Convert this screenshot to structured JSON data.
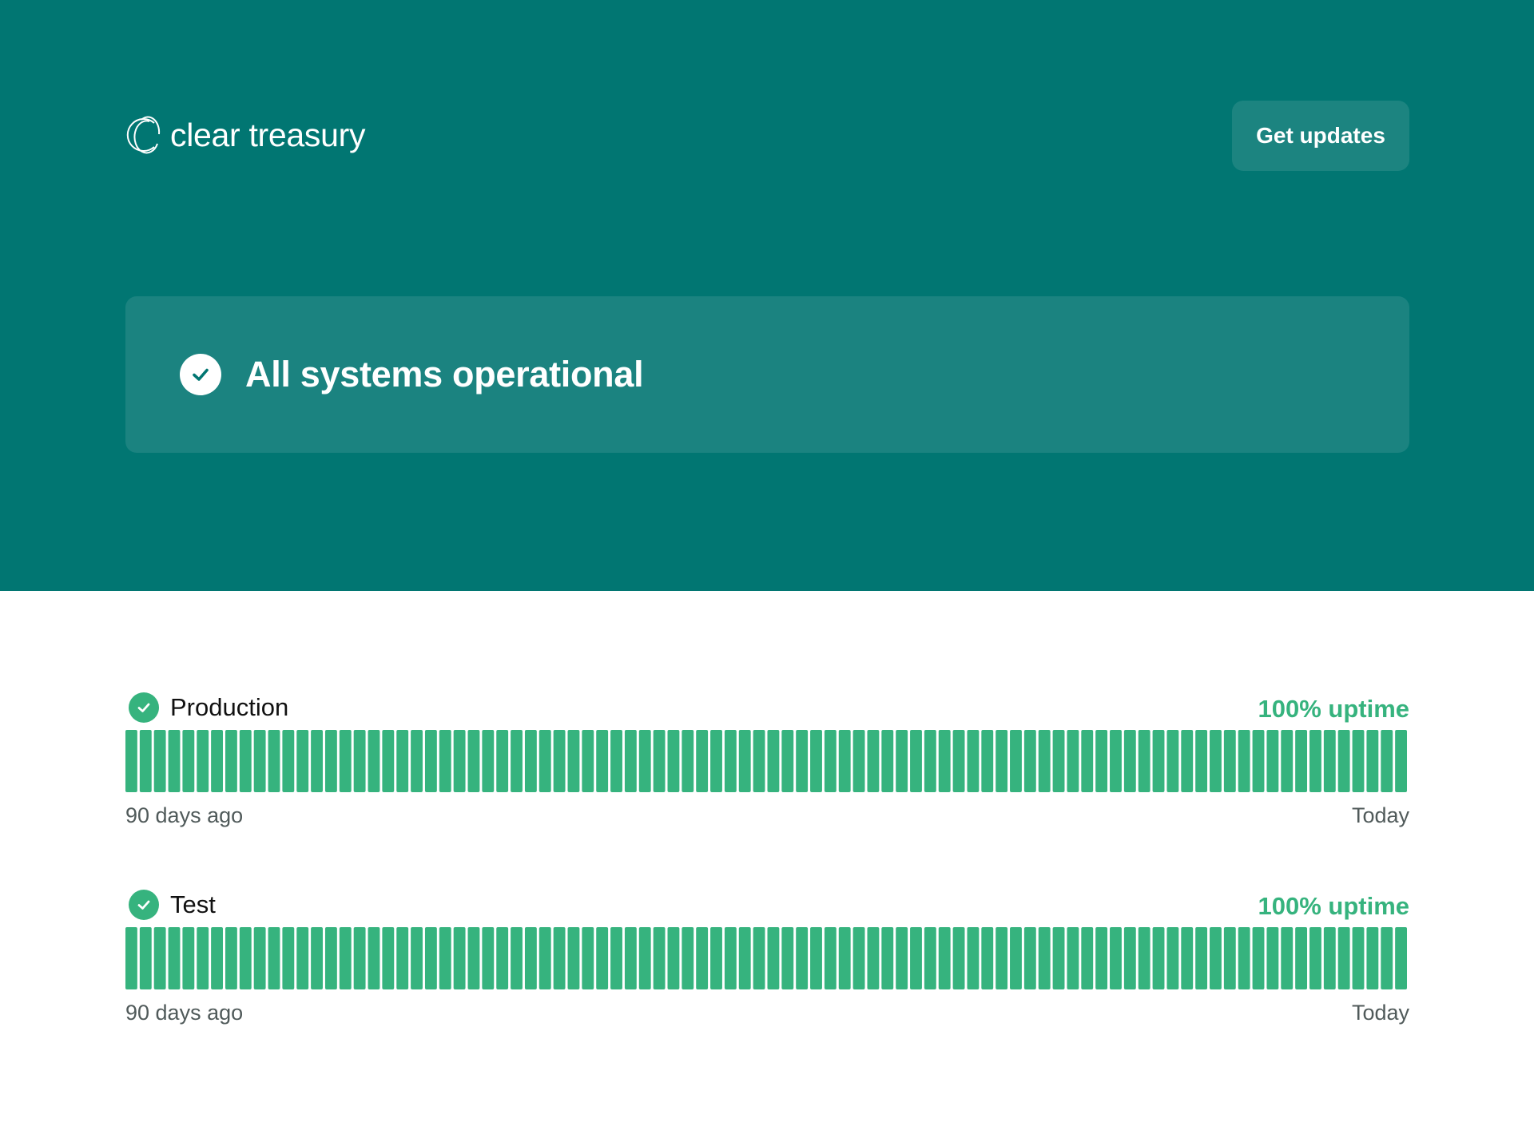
{
  "header": {
    "brand_name": "clear treasury",
    "logo_icon": "clear-treasury-logo-icon",
    "updates_button_label": "Get updates",
    "background_color": "#017672",
    "button_color": "#1c8480"
  },
  "status": {
    "message": "All systems operational",
    "icon": "check-circle-icon",
    "card_color": "#1b8380"
  },
  "components": [
    {
      "name": "Production",
      "status_icon": "check-circle-icon",
      "uptime_label": "100% uptime",
      "bar_count": 90,
      "bar_color": "#36b37e",
      "start_label": "90 days ago",
      "end_label": "Today"
    },
    {
      "name": "Test",
      "status_icon": "check-circle-icon",
      "uptime_label": "100% uptime",
      "bar_count": 90,
      "bar_color": "#36b37e",
      "start_label": "90 days ago",
      "end_label": "Today"
    }
  ]
}
